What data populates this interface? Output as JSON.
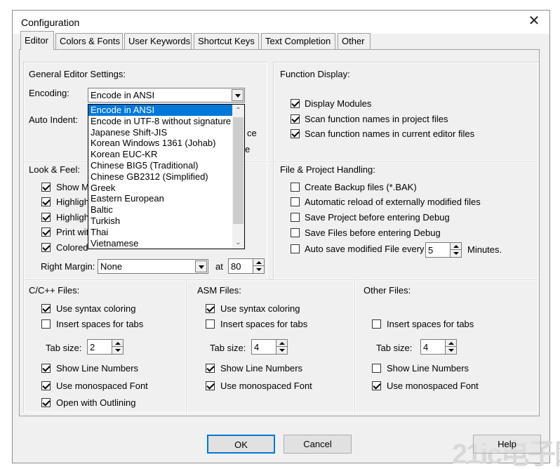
{
  "window": {
    "title": "Configuration",
    "close_glyph": "✕"
  },
  "tabs": [
    "Editor",
    "Colors & Fonts",
    "User Keywords",
    "Shortcut Keys",
    "Text Completion",
    "Other"
  ],
  "general": {
    "heading": "General Editor Settings:",
    "encoding_label": "Encoding:",
    "encoding_value": "Encode in ANSI",
    "auto_indent_label": "Auto Indent:",
    "hidden_fragment_1": "ce",
    "hidden_fragment_2": "e"
  },
  "encoding_options": [
    "Encode in ANSI",
    "Encode in UTF-8 without signature",
    "Japanese Shift-JIS",
    "Korean Windows 1361 (Johab)",
    "Korean EUC-KR",
    "Chinese BIG5 (Traditional)",
    "Chinese GB2312 (Simplified)",
    "Greek",
    "Eastern European",
    "Baltic",
    "Turkish",
    "Thai",
    "Vietnamese"
  ],
  "function_display": {
    "heading": "Function Display:",
    "items": [
      {
        "label": "Display Modules",
        "checked": true
      },
      {
        "label": "Scan function names in project files",
        "checked": true
      },
      {
        "label": "Scan function names in current editor files",
        "checked": true
      }
    ]
  },
  "look_feel": {
    "heading": "Look & Feel:",
    "items": [
      {
        "label": "Show M",
        "checked": true
      },
      {
        "label": "Highligh",
        "checked": true
      },
      {
        "label": "Highligh",
        "checked": true
      },
      {
        "label": "Print wit",
        "checked": true
      },
      {
        "label": "Colored",
        "checked": true
      }
    ],
    "right_margin_label": "Right Margin:",
    "right_margin_value": "None",
    "at_label": "at",
    "at_value": "80"
  },
  "file_project": {
    "heading": "File & Project Handling:",
    "items": [
      {
        "label": "Create Backup files (*.BAK)",
        "checked": false
      },
      {
        "label": "Automatic reload of externally modified files",
        "checked": false
      },
      {
        "label": "Save Project before entering Debug",
        "checked": false
      },
      {
        "label": "Save Files before entering Debug",
        "checked": false
      },
      {
        "label": "Auto save modified File every",
        "checked": false
      }
    ],
    "autosave_value": "5",
    "minutes_label": "Minutes."
  },
  "cpp": {
    "heading": "C/C++ Files:",
    "use_syntax": {
      "label": "Use syntax coloring",
      "checked": true
    },
    "insert_spaces": {
      "label": "Insert spaces for tabs",
      "checked": false
    },
    "tab_size_label": "Tab size:",
    "tab_size": "2",
    "show_line_numbers": {
      "label": "Show Line Numbers",
      "checked": true
    },
    "monospaced": {
      "label": "Use monospaced Font",
      "checked": true
    },
    "outlining": {
      "label": "Open with Outlining",
      "checked": true
    }
  },
  "asm": {
    "heading": "ASM Files:",
    "use_syntax": {
      "label": "Use syntax coloring",
      "checked": true
    },
    "insert_spaces": {
      "label": "Insert spaces for tabs",
      "checked": false
    },
    "tab_size_label": "Tab size:",
    "tab_size": "4",
    "show_line_numbers": {
      "label": "Show Line Numbers",
      "checked": true
    },
    "monospaced": {
      "label": "Use monospaced Font",
      "checked": true
    }
  },
  "other": {
    "heading": "Other Files:",
    "insert_spaces": {
      "label": "Insert spaces for tabs",
      "checked": false
    },
    "tab_size_label": "Tab size:",
    "tab_size": "4",
    "show_line_numbers": {
      "label": "Show Line Numbers",
      "checked": false
    },
    "monospaced": {
      "label": "Use monospaced Font",
      "checked": true
    }
  },
  "buttons": {
    "ok": "OK",
    "cancel": "Cancel",
    "help": "Help"
  },
  "watermark": "21ic电子网",
  "colors": {
    "selection": "#0078d7",
    "dialog_bg": "#f0f0f0"
  }
}
